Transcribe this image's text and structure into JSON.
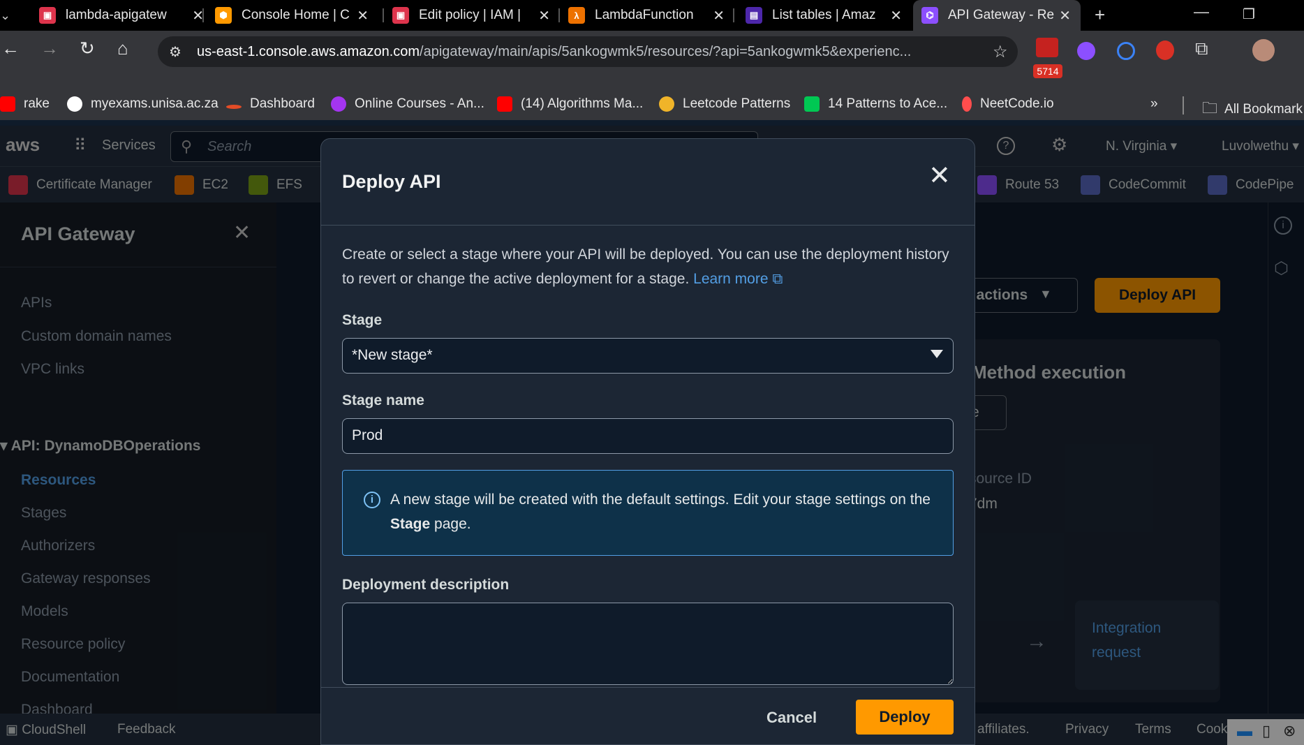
{
  "browser": {
    "tabs": [
      {
        "title": "lambda-apigatew",
        "fav_color": "#dd344c",
        "fav": "▣"
      },
      {
        "title": "Console Home | C",
        "fav_color": "#ff9900",
        "fav": "⬢"
      },
      {
        "title": "Edit policy | IAM |",
        "fav_color": "#dd344c",
        "fav": "▣"
      },
      {
        "title": "LambdaFunction",
        "fav_color": "#ed7100",
        "fav": "λ"
      },
      {
        "title": "List tables | Amaz",
        "fav_color": "#4d27aa",
        "fav": "▤"
      },
      {
        "title": "API Gateway - Re",
        "fav_color": "#8c4fff",
        "fav": "⌬"
      }
    ],
    "url_host": "us-east-1.console.aws.amazon.com",
    "url_path": "/apigateway/main/apis/5ankogwmk5/resources/?api=5ankogwmk5&experienc...",
    "ext_badge": "5714",
    "bookmarks": [
      {
        "label": "rake",
        "color": "#ff0000"
      },
      {
        "label": "myexams.unisa.ac.za",
        "color": "#ffffff"
      },
      {
        "label": "Dashboard",
        "color": "#e34c26"
      },
      {
        "label": "Online Courses - An...",
        "color": "#a435f0"
      },
      {
        "label": "(14) Algorithms Ma...",
        "color": "#ff0000"
      },
      {
        "label": "Leetcode Patterns",
        "color": "#f0b429"
      },
      {
        "label": "14 Patterns to Ace...",
        "color": "#00c853"
      },
      {
        "label": "NeetCode.io",
        "color": "#ff4d4d"
      }
    ],
    "all_bookmarks": "All Bookmark"
  },
  "aws": {
    "services": "Services",
    "search_placeholder": "Search",
    "region": "N. Virginia",
    "user": "Luvolwethu",
    "favorites": [
      {
        "label": "Certificate Manager",
        "color": "#dd344c"
      },
      {
        "label": "EC2",
        "color": "#ed7100"
      },
      {
        "label": "EFS",
        "color": "#7aa116"
      },
      {
        "label": "Route 53",
        "color": "#8c4fff"
      },
      {
        "label": "CodeCommit",
        "color": "#5a6bc4"
      },
      {
        "label": "CodePipe",
        "color": "#5a6bc4"
      }
    ]
  },
  "sidebar": {
    "title": "API Gateway",
    "top_links": [
      "APIs",
      "Custom domain names",
      "VPC links"
    ],
    "api_section": "API: DynamoDBOperations",
    "api_links": [
      "Resources",
      "Stages",
      "Authorizers",
      "Gateway responses",
      "Models",
      "Resource policy",
      "Documentation",
      "Dashboard"
    ]
  },
  "main": {
    "api_actions": "I actions",
    "deploy_api": "Deploy API",
    "method_execution": "Method execution",
    "partial_e": "e",
    "resource_id_label": "source ID",
    "resource_id_value": "7dm",
    "integration_request": "Integration request"
  },
  "footer": {
    "cloudshell": "CloudShell",
    "feedback": "Feedback",
    "affiliates": "affiliates.",
    "privacy": "Privacy",
    "terms": "Terms",
    "cookie": "Cook"
  },
  "modal": {
    "title": "Deploy API",
    "intro_text": "Create or select a stage where your API will be deployed. You can use the deployment history to revert or change the active deployment for a stage.",
    "learn_more": "Learn more",
    "stage_label": "Stage",
    "stage_value": "*New stage*",
    "stage_name_label": "Stage name",
    "stage_name_value": "Prod",
    "info_text_pre": "A new stage will be created with the default settings. Edit your stage settings on the",
    "info_text_bold": "Stage",
    "info_text_post": "page.",
    "description_label": "Deployment description",
    "description_value": "",
    "cancel_label": "Cancel",
    "deploy_label": "Deploy"
  }
}
